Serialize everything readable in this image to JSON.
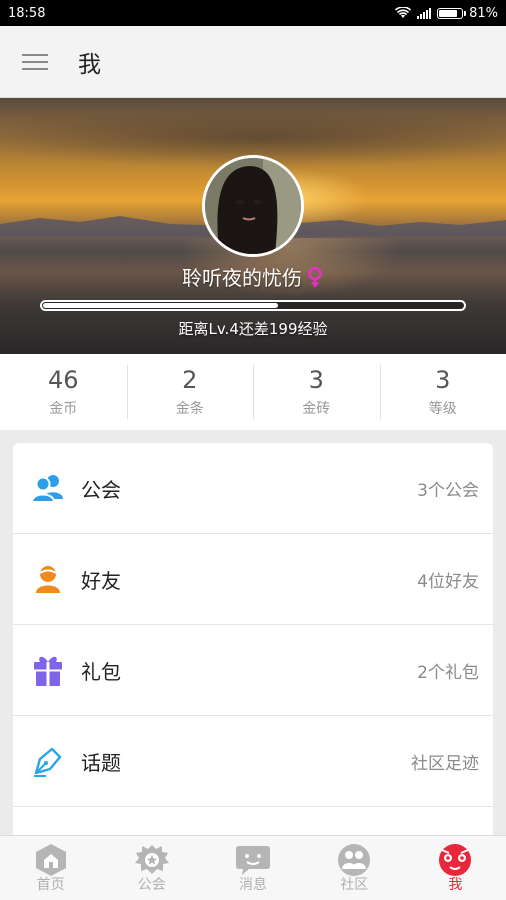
{
  "status": {
    "time": "18:58",
    "battery": "81%",
    "battery_level": 0.81
  },
  "header": {
    "title": "我"
  },
  "profile": {
    "username": "聆听夜的忧伤",
    "xp_text": "距离Lv.4还差199经验",
    "xp_progress": 0.56,
    "gender": "female"
  },
  "stats": [
    {
      "value": "46",
      "label": "金币"
    },
    {
      "value": "2",
      "label": "金条"
    },
    {
      "value": "3",
      "label": "金砖"
    },
    {
      "value": "3",
      "label": "等级"
    }
  ],
  "menu": [
    {
      "label": "公会",
      "value": "3个公会",
      "icon": "guild-icon"
    },
    {
      "label": "好友",
      "value": "4位好友",
      "icon": "friend-icon"
    },
    {
      "label": "礼包",
      "value": "2个礼包",
      "icon": "gift-icon"
    },
    {
      "label": "话题",
      "value": "社区足迹",
      "icon": "pen-icon"
    }
  ],
  "tabs": [
    {
      "label": "首页",
      "icon": "home-icon"
    },
    {
      "label": "公会",
      "icon": "guild-icon"
    },
    {
      "label": "消息",
      "icon": "message-icon"
    },
    {
      "label": "社区",
      "icon": "community-icon"
    },
    {
      "label": "我",
      "icon": "me-icon",
      "active": true
    }
  ],
  "colors": {
    "accent": "#e8273b",
    "guild": "#2f9ee8",
    "friend": "#f08a1e",
    "gift": "#7f63e8",
    "pen": "#2aa6e6",
    "tab_inactive": "#b0b0b0"
  }
}
